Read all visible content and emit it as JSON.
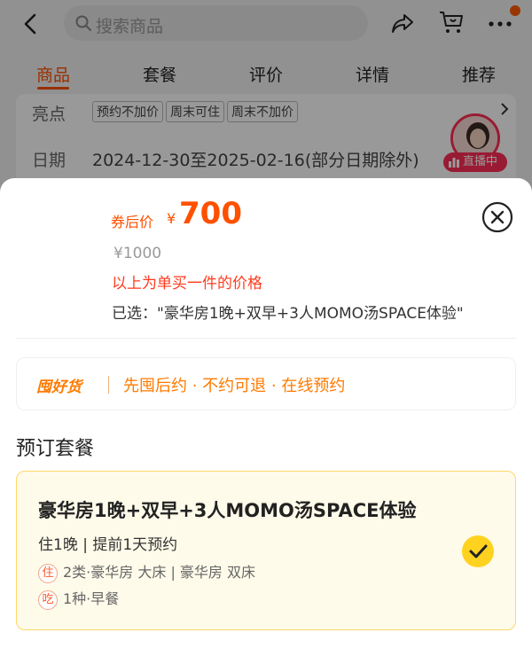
{
  "header": {
    "search_placeholder": "搜索商品"
  },
  "tabs": [
    {
      "label": "商品",
      "active": true
    },
    {
      "label": "套餐",
      "active": false
    },
    {
      "label": "评价",
      "active": false
    },
    {
      "label": "详情",
      "active": false
    },
    {
      "label": "推荐",
      "active": false
    }
  ],
  "info": {
    "highlights_label": "亮点",
    "tags": [
      "预约不加价",
      "周末可住",
      "周末不加价"
    ],
    "date_label": "日期",
    "date_value": "2024-12-30至2025-02-16(部分日期除外)",
    "live_label": "直播中"
  },
  "sheet": {
    "price_label": "券后价",
    "currency": "¥",
    "price": "700",
    "original_price": "¥1000",
    "single_note": "以上为单买一件的价格",
    "selected_text": "已选：\"豪华房1晚+双早+3人MOMO汤SPACE体验\"",
    "guarantee_logo": "囤好货",
    "guarantee_text": "先囤后约 · 不约可退 · 在线预约",
    "section_title": "预订套餐",
    "package": {
      "title": "豪华房1晚+双早+3人MOMO汤SPACE体验",
      "subtitle": "住1晚 | 提前1天预约",
      "stay_badge": "住",
      "stay_detail": "2类·豪华房 大床 | 豪华房 双床",
      "food_badge": "吃",
      "food_detail": "1种·早餐",
      "selected": true
    }
  },
  "colors": {
    "accent": "#ff5000",
    "guarantee": "#ff7a00",
    "check": "#ffd21f"
  }
}
